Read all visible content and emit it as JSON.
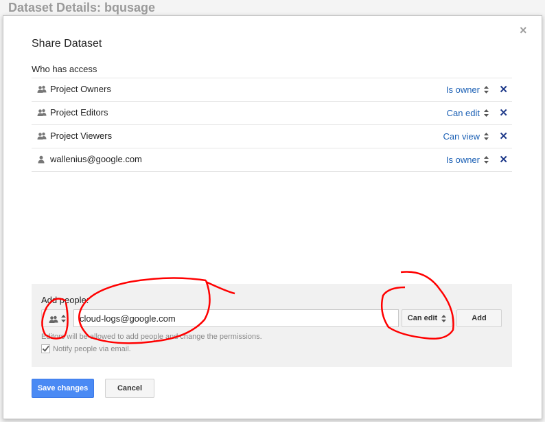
{
  "background": {
    "title": "Dataset Details: bqusage"
  },
  "dialog": {
    "close_icon": "×",
    "title": "Share Dataset",
    "access_label": "Who has access",
    "access_list": [
      {
        "name": "Project Owners",
        "permission": "Is owner",
        "icon": "group-icon"
      },
      {
        "name": "Project Editors",
        "permission": "Can edit",
        "icon": "group-icon"
      },
      {
        "name": "Project Viewers",
        "permission": "Can view",
        "icon": "group-icon"
      },
      {
        "name": "wallenius@google.com",
        "permission": "Is owner",
        "icon": "person-icon"
      }
    ],
    "remove_glyph": "✕",
    "add_people": {
      "label": "Add people:",
      "type_icon": "group-icon",
      "email_value": "cloud-logs@google.com",
      "permission": "Can edit",
      "add_label": "Add",
      "hint": "Editors will be allowed to add people and change the permissions.",
      "notify_label": "Notify people via email.",
      "notify_checked": true
    },
    "save_label": "Save changes",
    "cancel_label": "Cancel"
  },
  "colors": {
    "link": "#1a5fb4",
    "remove": "#1f3a8a",
    "primary_button": "#4a8af4",
    "annotation": "#ff0000"
  }
}
